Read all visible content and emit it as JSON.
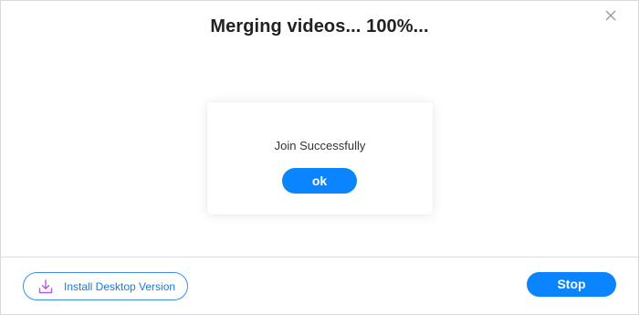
{
  "dialog": {
    "title": "Merging videos... 100%..."
  },
  "popup": {
    "message": "Join Successfully",
    "ok_label": "ok"
  },
  "footer": {
    "install_label": "Install Desktop Version",
    "stop_label": "Stop"
  },
  "progress": {
    "percent": 100
  },
  "icons": {
    "close": "close-icon",
    "download": "download-icon"
  },
  "colors": {
    "primary": "#0b84ff",
    "install_border": "#3b8fe6",
    "install_text": "#1e78d2",
    "download_icon": "#b15ce0",
    "title_text": "#222222"
  }
}
